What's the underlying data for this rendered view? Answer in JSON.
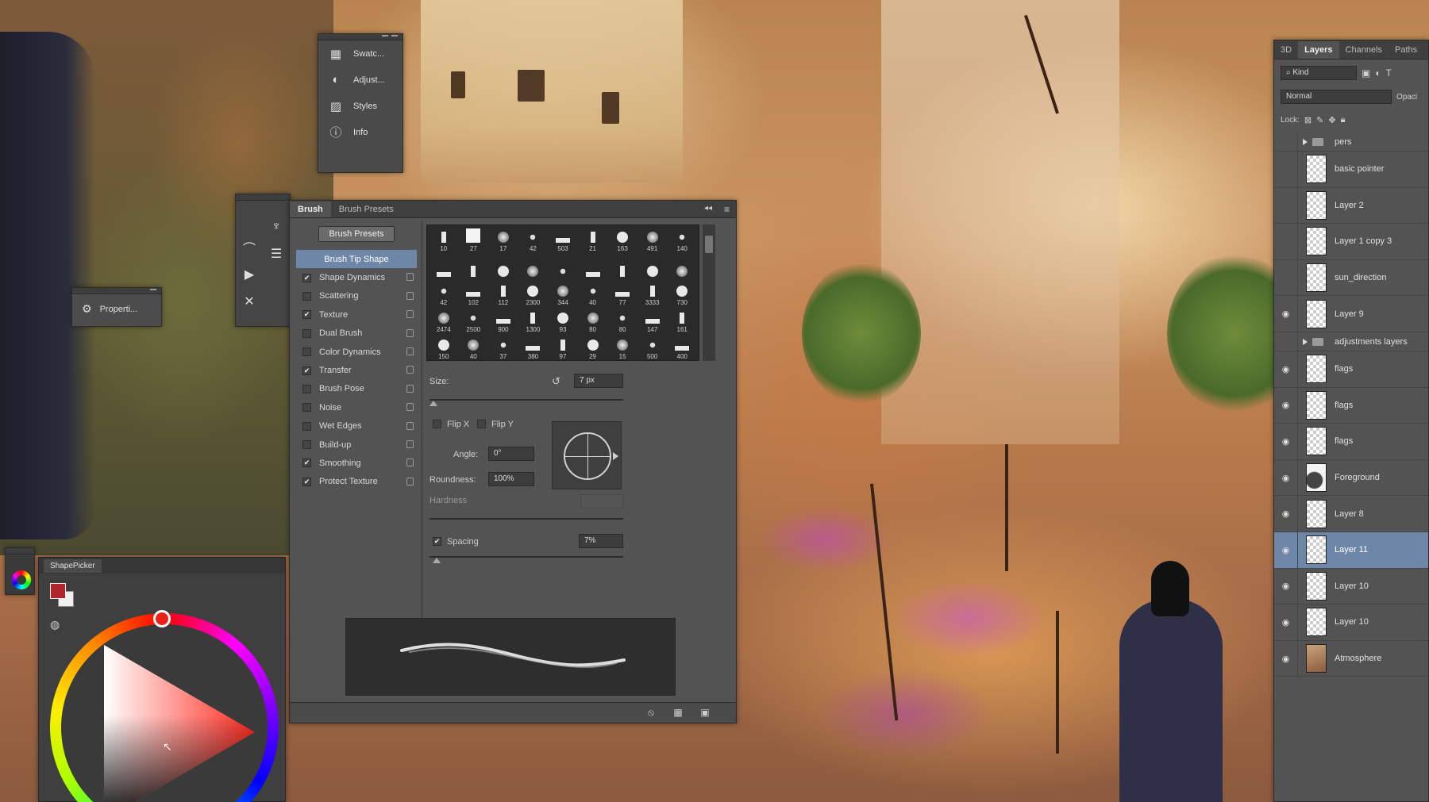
{
  "mini_panel": {
    "items": [
      {
        "label": "Swatc...",
        "icon": "swatches-icon"
      },
      {
        "label": "Adjust...",
        "icon": "adjustments-icon"
      },
      {
        "label": "Styles",
        "icon": "styles-icon"
      },
      {
        "label": "Info",
        "icon": "info-icon"
      }
    ]
  },
  "properties_panel": {
    "label": "Properti..."
  },
  "brush_panel": {
    "tabs": [
      "Brush",
      "Brush Presets"
    ],
    "presets_button": "Brush Presets",
    "options": [
      {
        "label": "Brush Tip Shape",
        "checked": null,
        "active": true
      },
      {
        "label": "Shape Dynamics",
        "checked": true
      },
      {
        "label": "Scattering",
        "checked": false
      },
      {
        "label": "Texture",
        "checked": true
      },
      {
        "label": "Dual Brush",
        "checked": false
      },
      {
        "label": "Color Dynamics",
        "checked": false
      },
      {
        "label": "Transfer",
        "checked": true
      },
      {
        "label": "Brush Pose",
        "checked": false
      },
      {
        "label": "Noise",
        "checked": false
      },
      {
        "label": "Wet Edges",
        "checked": false
      },
      {
        "label": "Build-up",
        "checked": false
      },
      {
        "label": "Smoothing",
        "checked": true
      },
      {
        "label": "Protect Texture",
        "checked": true
      }
    ],
    "tip_sizes": [
      "10",
      "27",
      "17",
      "42",
      "503",
      "21",
      "163",
      "491",
      "140",
      "",
      "",
      "",
      "",
      "",
      "",
      "",
      "",
      "",
      "42",
      "102",
      "112",
      "2300",
      "344",
      "40",
      "77",
      "3333",
      "730",
      "2474",
      "2500",
      "900",
      "1300",
      "93",
      "80",
      "80",
      "147",
      "161",
      "150",
      "40",
      "37",
      "380",
      "97",
      "29",
      "15",
      "500",
      "400",
      "",
      "",
      "",
      "",
      "",
      "",
      "",
      "",
      ""
    ],
    "size_label": "Size:",
    "size_value": "7 px",
    "flip_x": "Flip X",
    "flip_y": "Flip Y",
    "angle_label": "Angle:",
    "angle_value": "0°",
    "roundness_label": "Roundness:",
    "roundness_value": "100%",
    "hardness_label": "Hardness",
    "spacing_label": "Spacing",
    "spacing_value": "7%"
  },
  "shape_picker": {
    "tab": "ShapePicker",
    "foreground_color": "#b0262c",
    "background_color": "#f0f0f0"
  },
  "layers_panel": {
    "tabs": [
      "3D",
      "Layers",
      "Channels",
      "Paths"
    ],
    "kind_filter": "Kind",
    "blend_mode": "Normal",
    "opacity_label": "Opaci",
    "lock_label": "Lock:",
    "layers": [
      {
        "name": "pers",
        "type": "group",
        "visible": false
      },
      {
        "name": "basic pointer",
        "visible": false
      },
      {
        "name": "Layer 2",
        "visible": false
      },
      {
        "name": "Layer 1 copy 3",
        "visible": false
      },
      {
        "name": "sun_direction",
        "visible": false
      },
      {
        "name": "Layer 9",
        "visible": true
      },
      {
        "name": "adjustments layers",
        "type": "group",
        "visible": false
      },
      {
        "name": "flags",
        "visible": true
      },
      {
        "name": "flags",
        "visible": true
      },
      {
        "name": "flags",
        "visible": true
      },
      {
        "name": "Foreground",
        "visible": true,
        "thumb": "blob"
      },
      {
        "name": "Layer 8",
        "visible": true
      },
      {
        "name": "Layer 11",
        "visible": true,
        "selected": true
      },
      {
        "name": "Layer 10",
        "visible": true
      },
      {
        "name": "Layer 10",
        "visible": true
      },
      {
        "name": "Atmosphere",
        "visible": true,
        "thumb": "img"
      }
    ]
  }
}
